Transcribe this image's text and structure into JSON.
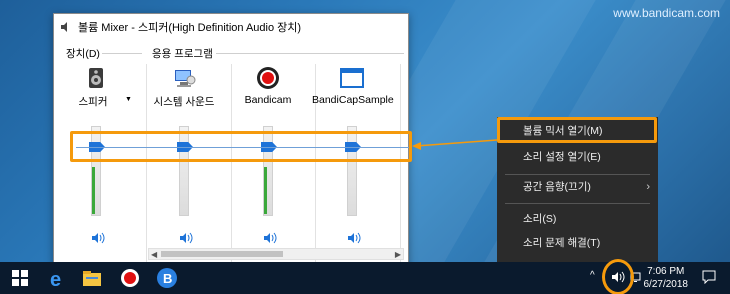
{
  "watermark": "www.bandicam.com",
  "window": {
    "title": "볼륨 Mixer - 스피커(High Definition Audio 장치)",
    "device_label": "장치(D)",
    "apps_label": "응용 프로그램"
  },
  "channels": [
    {
      "name": "스피커",
      "icon": "speaker-icon",
      "volume": 0.7,
      "peak": 0.5
    },
    {
      "name": "시스템 사운드",
      "icon": "system-sounds-icon",
      "volume": 0.7,
      "peak": 0.0
    },
    {
      "name": "Bandicam",
      "icon": "bandicam-record-icon",
      "volume": 0.7,
      "peak": 0.5
    },
    {
      "name": "BandiCapSample",
      "icon": "window-app-icon",
      "volume": 0.7,
      "peak": 0.0
    }
  ],
  "menu": {
    "items": [
      "볼륨 믹서 열기(M)",
      "소리 설정 열기(E)",
      "공간 음향(끄기)",
      "소리(S)",
      "소리 문제 해결(T)"
    ]
  },
  "tray": {
    "time": "7:06 PM",
    "date": "6/27/2018"
  },
  "colors": {
    "highlight": "#f59a0c",
    "thumb": "#1e73d8",
    "level": "#3aa83a"
  }
}
